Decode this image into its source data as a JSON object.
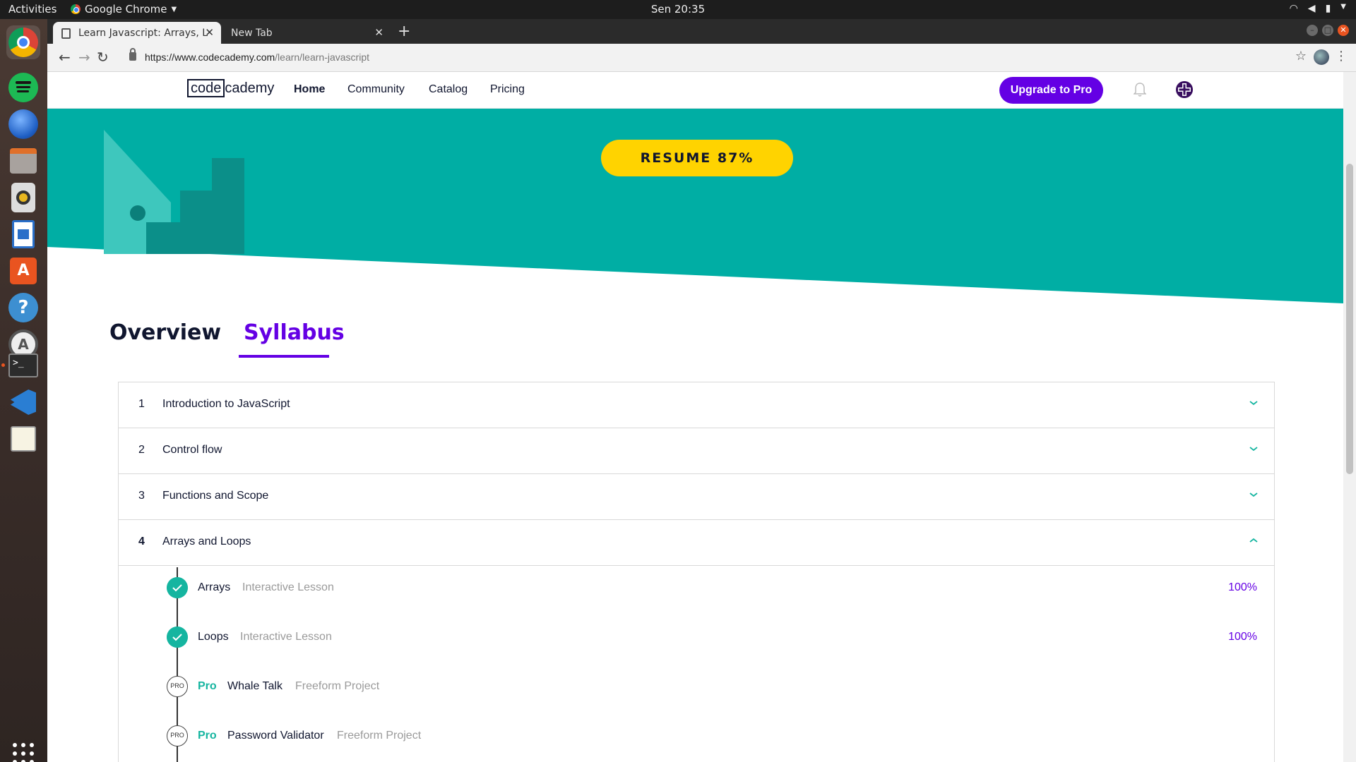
{
  "topbar": {
    "activities": "Activities",
    "app_name": "Google Chrome",
    "clock": "Sen 20:35"
  },
  "dock": {
    "items": [
      "chrome-icon",
      "spotify-icon",
      "thunderbird-icon",
      "files-icon",
      "rhythmbox-icon",
      "writer-icon",
      "software-center-icon",
      "help-icon",
      "updater-icon",
      "terminal-icon",
      "vscode-icon",
      "text-editor-icon",
      "show-apps-icon"
    ]
  },
  "browser": {
    "tabs": [
      {
        "label": "Learn Javascript: Arrays, L"
      },
      {
        "label": "New Tab"
      }
    ],
    "url_host": "https://www.codecademy.com",
    "url_path": "/learn/learn-javascript"
  },
  "site": {
    "logo_boxed": "code",
    "logo_rest": "cademy",
    "nav": [
      "Home",
      "Community",
      "Catalog",
      "Pricing"
    ],
    "upgrade_label": "Upgrade to Pro",
    "resume_label": "RESUME 87%"
  },
  "page_tabs": {
    "overview": "Overview",
    "syllabus": "Syllabus"
  },
  "modules": [
    {
      "num": "1",
      "title": "Introduction to JavaScript",
      "expanded": false
    },
    {
      "num": "2",
      "title": "Control flow",
      "expanded": false
    },
    {
      "num": "3",
      "title": "Functions and Scope",
      "expanded": false
    },
    {
      "num": "4",
      "title": "Arrays and Loops",
      "expanded": true
    }
  ],
  "lessons": [
    {
      "title": "Arrays",
      "type": "Interactive Lesson",
      "progress": "100%",
      "completed": true,
      "pro": false
    },
    {
      "title": "Loops",
      "type": "Interactive Lesson",
      "progress": "100%",
      "completed": true,
      "pro": false
    },
    {
      "title": "Whale Talk",
      "type": "Freeform Project",
      "pro_label": "Pro",
      "pro_badge": "PRO",
      "completed": false,
      "pro": true
    },
    {
      "title": "Password Validator",
      "type": "Freeform Project",
      "pro_label": "Pro",
      "pro_badge": "PRO",
      "completed": false,
      "pro": true
    }
  ],
  "colors": {
    "brand_purple": "#6400e4",
    "hero_teal": "#00aea4",
    "resume_yellow": "#ffd300",
    "check_teal": "#15b5a0"
  }
}
